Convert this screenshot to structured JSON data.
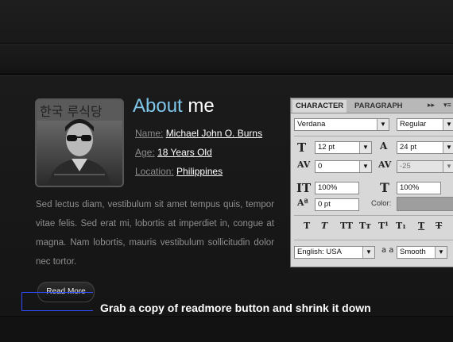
{
  "about": {
    "title_accent": "About",
    "title_rest": "me",
    "name_label": "Name:",
    "name_value": "Michael John O. Burns",
    "age_label": "Age:",
    "age_value": "18 Years Old",
    "location_label": "Location:",
    "location_value": "Philippines",
    "bio": "Sed lectus diam, vestibulum sit amet tempus quis, tempor vitae felis. Sed erat mi, lobortis at imperdiet in, congue at magna. Nam lobortis, mauris vestibulum sollicitudin dolor nec tortor.",
    "avatar_sign_text": "한국 루식당"
  },
  "readmore_label": "Read More",
  "callout_text": "Grab a copy of readmore button and shrink it down",
  "character_panel": {
    "tab_character": "CHARACTER",
    "tab_paragraph": "PARAGRAPH",
    "menu_arrows": "▸▸",
    "font_family": "Verdana",
    "font_style": "Regular",
    "font_size": "12 pt",
    "leading": "24 pt",
    "kerning": "0",
    "tracking": "-25",
    "vertical_scale": "100%",
    "horizontal_scale": "100%",
    "baseline_shift": "0 pt",
    "color_label": "Color:",
    "language": "English: USA",
    "antialias_symbol": "a a",
    "antialias": "Smooth",
    "format_buttons": [
      "T",
      "T",
      "TT",
      "Tт",
      "T¹",
      "T₁",
      "T",
      "T"
    ]
  },
  "colors": {
    "accent": "#7ec6ea",
    "background": "#161616",
    "callout_line": "#2f4cff",
    "panel_bg": "#d8d8d8",
    "swatch": "#9e9e9e"
  }
}
